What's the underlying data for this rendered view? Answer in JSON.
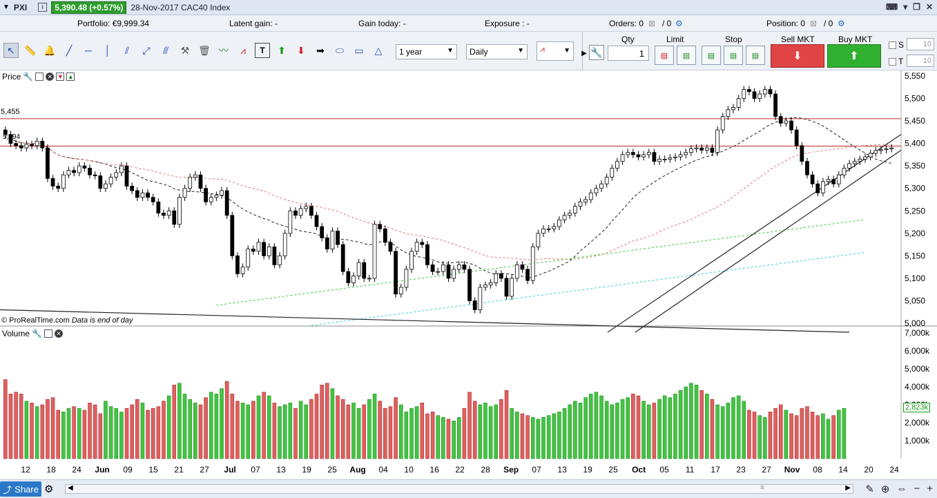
{
  "titlebar": {
    "symbol": "PXI",
    "price": "5,390.48 (+0.57%)",
    "date_title": "28-Nov-2017 CAC40 Index"
  },
  "info": {
    "portfolio": "Portfolio: €9,999.34",
    "latent": "Latent gain: -",
    "gain_today": "Gain today: -",
    "exposure": "Exposure : -",
    "orders": "Orders: 0",
    "orders_count": "/ 0",
    "position": "Position: 0",
    "position_count": "/ 0"
  },
  "toolbar": {
    "period": "1 year",
    "interval": "Daily",
    "qty_label": "Qty",
    "qty_value": "1",
    "limit_label": "Limit",
    "stop_label": "Stop",
    "sell_label": "Sell MKT",
    "buy_label": "Buy MKT",
    "s_label": "S",
    "t_label": "T",
    "s_value": "10",
    "t_value": "10"
  },
  "price_panel": {
    "title": "Price",
    "copyright": "© ProRealTime.com",
    "note": "Data is end of day",
    "level1": "5,455",
    "level2": "5,394"
  },
  "volume_panel": {
    "title": "Volume",
    "current": "2,823k"
  },
  "share_label": "Share",
  "chart_data": {
    "type": "candlestick",
    "y_ticks": [
      "5,550",
      "5,500",
      "5,450",
      "5,400",
      "5,350",
      "5,300",
      "5,250",
      "5,200",
      "5,150",
      "5,100",
      "5,050",
      "5,000"
    ],
    "vol_ticks": [
      "7,000k",
      "6,000k",
      "5,000k",
      "4,000k",
      "3,000k",
      "2,000k",
      "1,000k"
    ],
    "x_labels": [
      "12",
      "18",
      "24",
      "Jun",
      "09",
      "15",
      "21",
      "27",
      "Jul",
      "07",
      "13",
      "19",
      "25",
      "Aug",
      "04",
      "10",
      "16",
      "22",
      "28",
      "Sep",
      "07",
      "13",
      "19",
      "25",
      "Oct",
      "05",
      "11",
      "17",
      "23",
      "27",
      "Nov",
      "08",
      "14",
      "20",
      "24"
    ],
    "closes": [
      5420,
      5400,
      5395,
      5390,
      5398,
      5395,
      5405,
      5390,
      5322,
      5305,
      5300,
      5330,
      5340,
      5335,
      5350,
      5345,
      5330,
      5328,
      5300,
      5310,
      5325,
      5335,
      5350,
      5305,
      5295,
      5280,
      5290,
      5280,
      5270,
      5245,
      5240,
      5250,
      5220,
      5280,
      5300,
      5325,
      5330,
      5300,
      5270,
      5280,
      5285,
      5295,
      5240,
      5150,
      5110,
      5125,
      5165,
      5160,
      5180,
      5150,
      5170,
      5130,
      5150,
      5200,
      5250,
      5240,
      5255,
      5260,
      5240,
      5215,
      5190,
      5165,
      5205,
      5175,
      5115,
      5090,
      5105,
      5135,
      5100,
      5100,
      5220,
      5210,
      5180,
      5160,
      5065,
      5080,
      5120,
      5160,
      5180,
      5175,
      5130,
      5115,
      5115,
      5130,
      5100,
      5120,
      5130,
      5120,
      5050,
      5030,
      5080,
      5085,
      5090,
      5110,
      5100,
      5060,
      5100,
      5130,
      5120,
      5095,
      5170,
      5200,
      5210,
      5210,
      5215,
      5230,
      5240,
      5245,
      5260,
      5270,
      5275,
      5290,
      5300,
      5310,
      5325,
      5345,
      5360,
      5375,
      5380,
      5375,
      5370,
      5375,
      5380,
      5360,
      5365,
      5365,
      5368,
      5370,
      5375,
      5380,
      5388,
      5390,
      5385,
      5390,
      5380,
      5430,
      5460,
      5475,
      5480,
      5500,
      5520,
      5515,
      5500,
      5510,
      5520,
      5510,
      5460,
      5445,
      5450,
      5430,
      5395,
      5360,
      5330,
      5310,
      5290,
      5315,
      5320,
      5310,
      5330,
      5345,
      5355,
      5360,
      5365,
      5370,
      5378,
      5384,
      5386,
      5388,
      5390
    ],
    "volumes": [
      4.4,
      3.6,
      3.7,
      3.6,
      3.2,
      3.1,
      2.9,
      3.0,
      3.3,
      3.4,
      2.7,
      2.6,
      2.8,
      2.9,
      2.8,
      2.7,
      3.1,
      3.0,
      2.5,
      3.2,
      2.9,
      2.8,
      2.6,
      2.8,
      3.0,
      3.3,
      3.1,
      2.7,
      2.8,
      2.9,
      3.2,
      3.5,
      4.1,
      4.2,
      3.6,
      3.3,
      3.1,
      3.0,
      3.4,
      3.7,
      3.6,
      3.9,
      4.3,
      3.6,
      3.2,
      3.1,
      3.0,
      3.2,
      3.5,
      3.7,
      3.5,
      3.1,
      2.9,
      3.0,
      3.1,
      2.8,
      3.2,
      3.0,
      3.3,
      3.6,
      4.1,
      4.2,
      3.9,
      3.5,
      3.3,
      3.0,
      3.1,
      2.8,
      3.0,
      3.3,
      3.6,
      3.2,
      2.8,
      2.9,
      3.4,
      3.0,
      2.6,
      2.8,
      2.9,
      3.1,
      2.5,
      2.6,
      2.4,
      2.3,
      2.2,
      2.1,
      2.3,
      2.8,
      3.7,
      3.2,
      3.0,
      3.1,
      2.9,
      3.0,
      3.3,
      3.8,
      2.8,
      2.6,
      2.5,
      2.4,
      2.3,
      2.2,
      2.3,
      2.4,
      2.5,
      2.6,
      2.8,
      3.0,
      3.2,
      3.1,
      3.4,
      3.6,
      3.7,
      3.5,
      3.2,
      3.0,
      3.1,
      3.3,
      3.4,
      3.6,
      3.5,
      3.2,
      3.0,
      3.1,
      3.3,
      3.5,
      3.4,
      3.6,
      3.8,
      4.0,
      4.2,
      4.1,
      3.8,
      3.6,
      3.3,
      3.0,
      2.9,
      3.1,
      3.4,
      3.5,
      3.2,
      2.7,
      2.6,
      2.4,
      2.3,
      2.6,
      2.8,
      3.0,
      2.7,
      2.5,
      2.4,
      2.8,
      2.9,
      2.6,
      2.4,
      2.5,
      2.2,
      2.4,
      2.7,
      2.8
    ]
  }
}
